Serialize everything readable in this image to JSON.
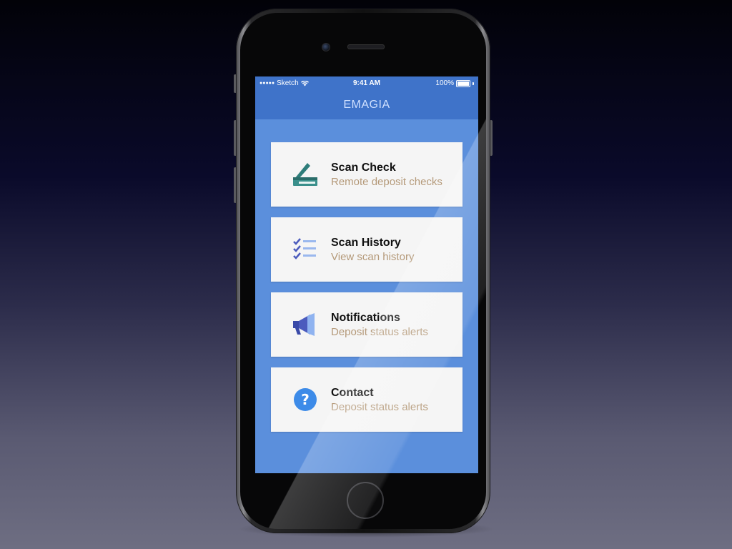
{
  "status_bar": {
    "signal": "●●●●●",
    "carrier": "Sketch",
    "time": "9:41 AM",
    "battery": "100%"
  },
  "app": {
    "title": "EMAGIA"
  },
  "menu": {
    "items": [
      {
        "title": "Scan Check",
        "subtitle": "Remote deposit checks",
        "icon": "scanner-icon"
      },
      {
        "title": "Scan History",
        "subtitle": "View scan history",
        "icon": "checklist-icon"
      },
      {
        "title": "Notifications",
        "subtitle": "Deposit status alerts",
        "icon": "megaphone-icon"
      },
      {
        "title": "Contact",
        "subtitle": "Deposit status alerts",
        "icon": "question-icon"
      }
    ]
  },
  "colors": {
    "background": "#5b8fdc",
    "header": "#3f73c9",
    "card": "#f5f5f5",
    "subtitle": "#b59a7a"
  }
}
